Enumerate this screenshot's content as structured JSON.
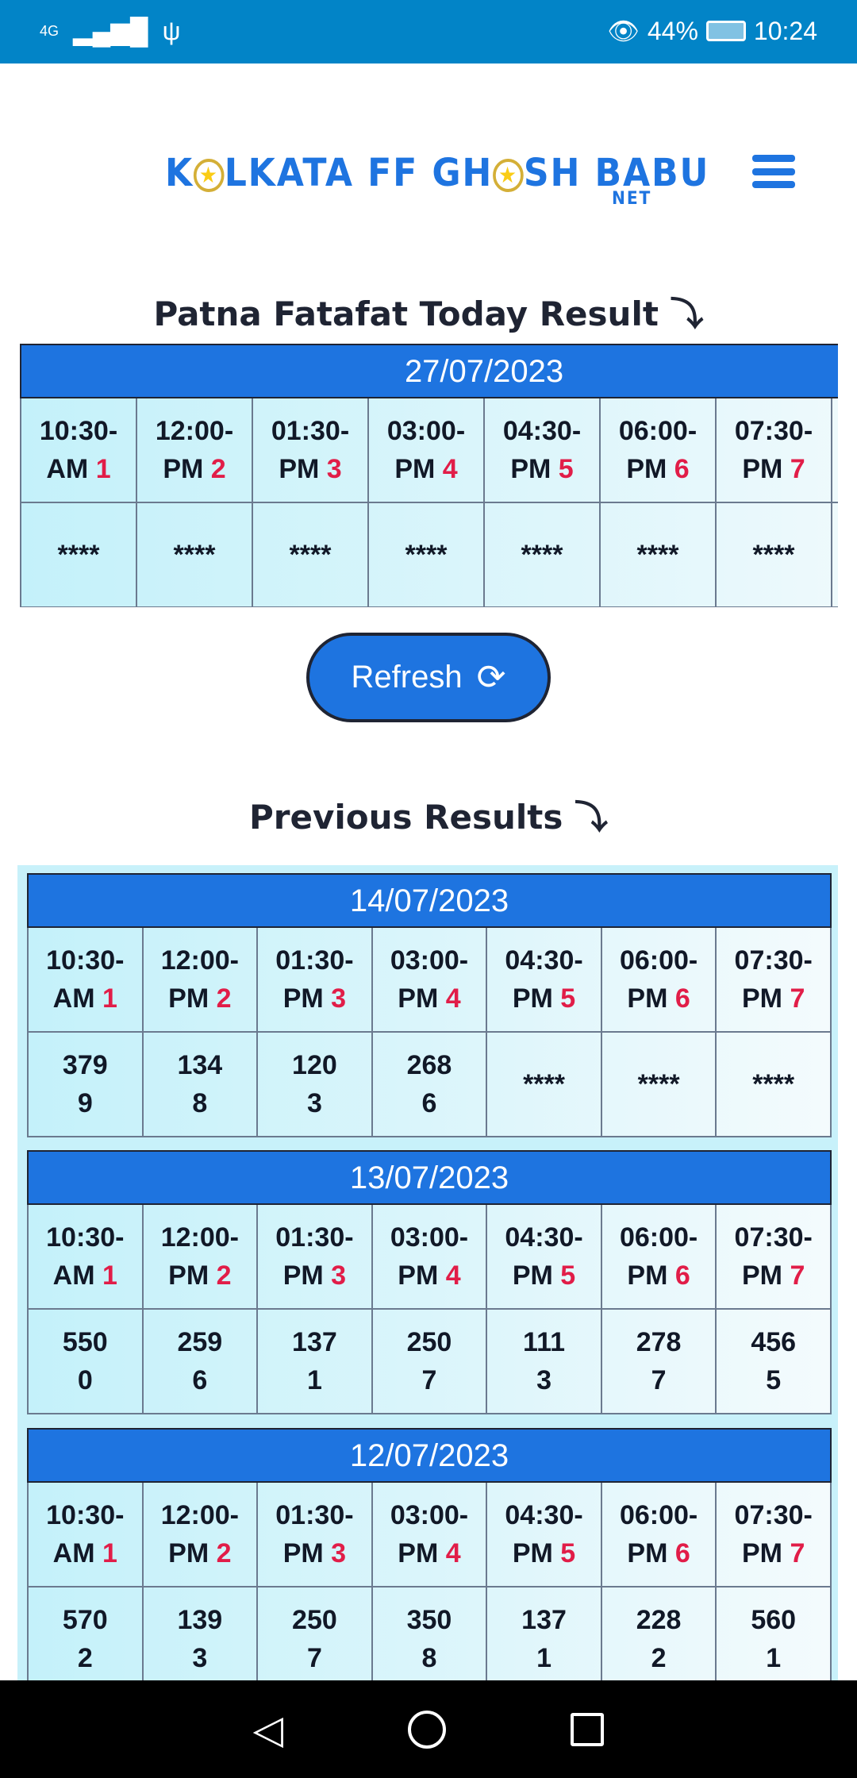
{
  "status_bar": {
    "network": "4G",
    "battery": "44%",
    "time": "10:24",
    "icons": [
      "signal-icon",
      "usb-icon",
      "eye-comfort-icon",
      "battery-charging-icon"
    ]
  },
  "header": {
    "logo_text": "KOLKATA FF GHOSH BABU",
    "logo_suffix": "NET",
    "menu_icon": "hamburger-icon"
  },
  "today": {
    "title": "Patna Fatafat Today Result ⤵",
    "date": "27/07/2023",
    "values": [
      "****",
      "****",
      "****",
      "****",
      "****",
      "****",
      "****"
    ]
  },
  "slots": [
    {
      "time": "10:30-",
      "ampm": "AM",
      "num": "1"
    },
    {
      "time": "12:00-",
      "ampm": "PM",
      "num": "2"
    },
    {
      "time": "01:30-",
      "ampm": "PM",
      "num": "3"
    },
    {
      "time": "03:00-",
      "ampm": "PM",
      "num": "4"
    },
    {
      "time": "04:30-",
      "ampm": "PM",
      "num": "5"
    },
    {
      "time": "06:00-",
      "ampm": "PM",
      "num": "6"
    },
    {
      "time": "07:30-",
      "ampm": "PM",
      "num": "7"
    }
  ],
  "refresh": {
    "label": "Refresh",
    "icon": "refresh-icon"
  },
  "previous": {
    "title": "Previous Results ⤵",
    "results": [
      {
        "date": "14/07/2023",
        "values": [
          "3799",
          "1348",
          "1203",
          "2686",
          "****",
          "****",
          "****"
        ]
      },
      {
        "date": "13/07/2023",
        "values": [
          "5500",
          "2596",
          "1371",
          "2507",
          "1113",
          "2787",
          "4565"
        ]
      },
      {
        "date": "12/07/2023",
        "values": [
          "5702",
          "1393",
          "2507",
          "3508",
          "1371",
          "2282",
          "5601"
        ]
      }
    ]
  },
  "colors": {
    "status_bar": "#0284c7",
    "accent": "#1e74e0",
    "slot_number": "#e11d48"
  }
}
